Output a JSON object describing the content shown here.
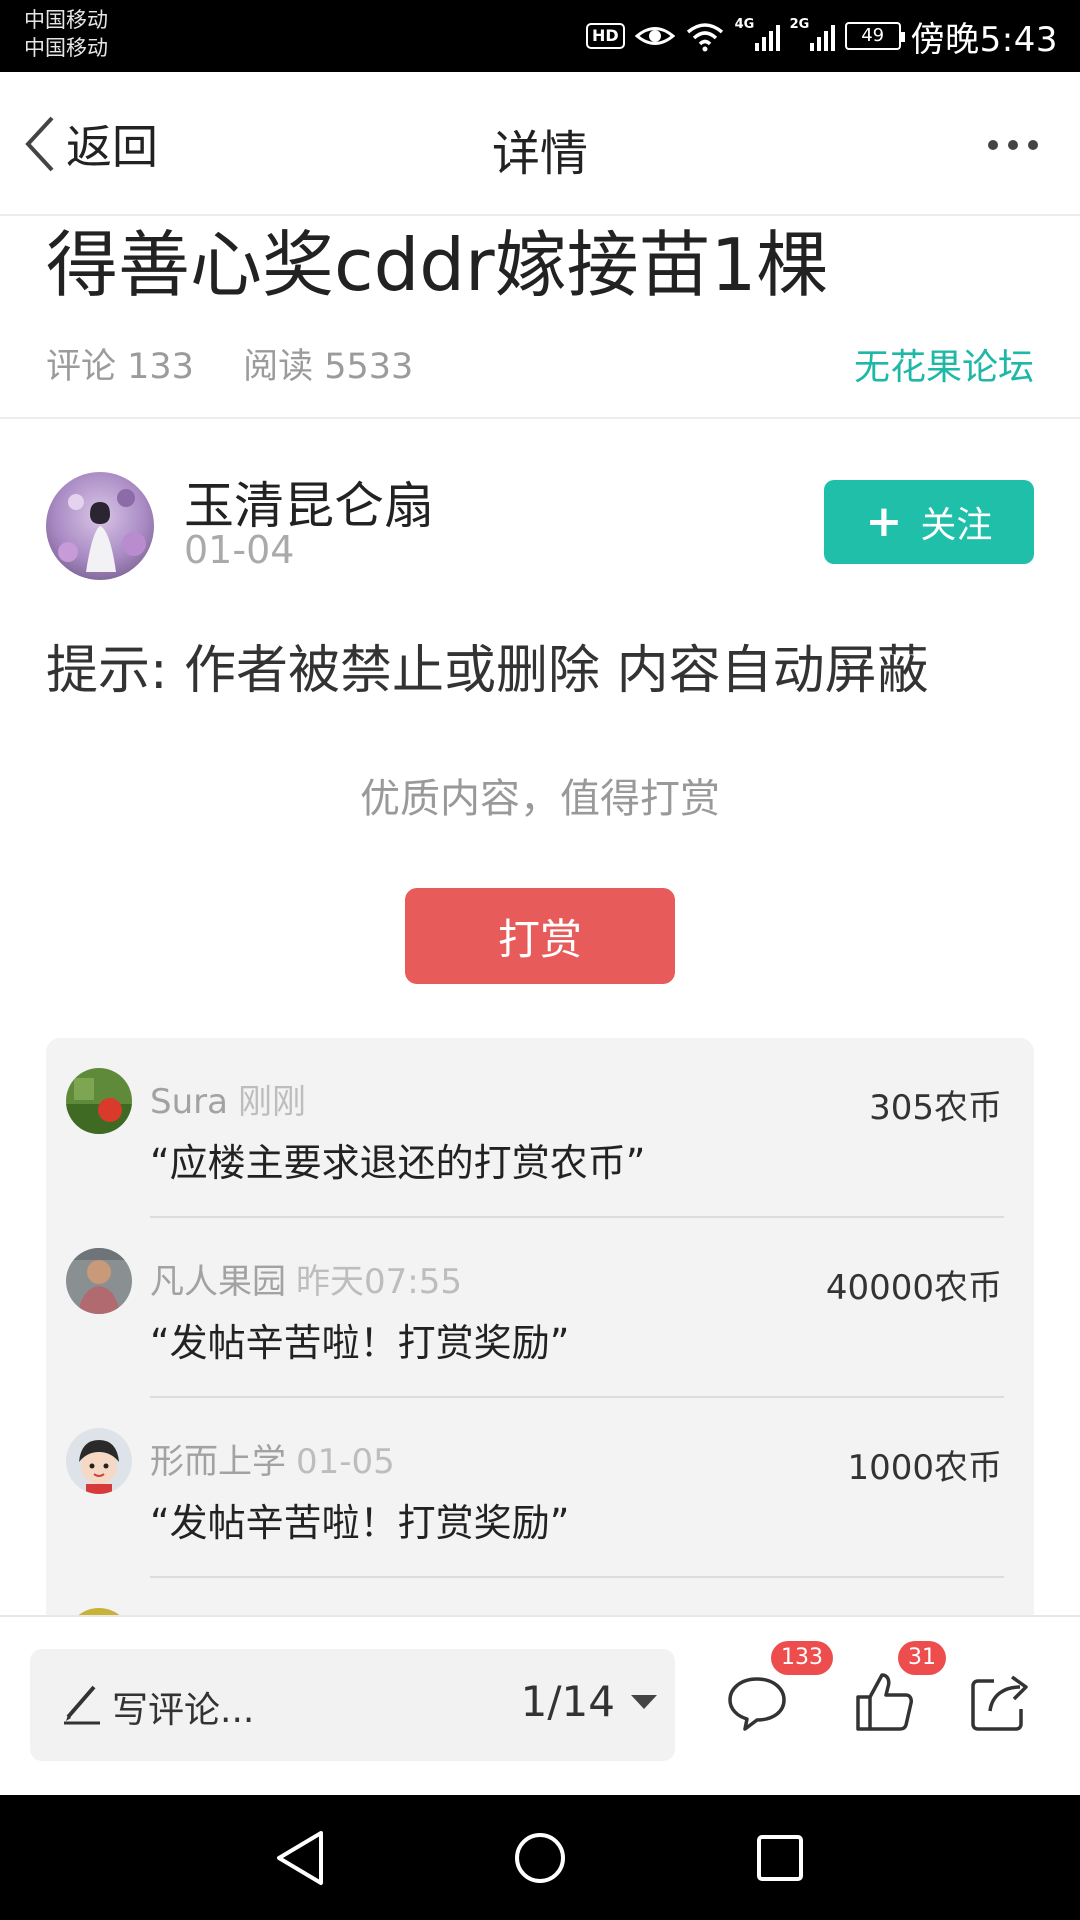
{
  "status_bar": {
    "carrier_1": "中国移动",
    "carrier_2": "中国移动",
    "hd": "HD",
    "net_1": "4G",
    "net_2": "2G",
    "battery": "49",
    "time": "傍晚5:43"
  },
  "header": {
    "back_label": "返回",
    "title": "详情"
  },
  "post": {
    "title": "得善心奖cddr嫁接苗1棵",
    "comments_label": "评论 133",
    "reads_label": "阅读 5533",
    "forum": "无花果论坛",
    "author_name": "玉清昆仑扇",
    "author_date": "01-04",
    "follow_plus": "+",
    "follow_label": "关注",
    "notice": "提示: 作者被禁止或删除 内容自动屏蔽"
  },
  "reward": {
    "hint": "优质内容，值得打赏",
    "button_label": "打赏",
    "items": [
      {
        "name": "Sura",
        "time": "刚刚",
        "amount": "305农币",
        "message": "“应楼主要求退还的打赏农币”"
      },
      {
        "name": "凡人果园",
        "time": "昨天07:55",
        "amount": "40000农币",
        "message": "“发帖辛苦啦！打赏奖励”"
      },
      {
        "name": "形而上学",
        "time": "01-05",
        "amount": "1000农币",
        "message": "“发帖辛苦啦！打赏奖励”"
      }
    ]
  },
  "bottom_bar": {
    "comment_placeholder": "写评论...",
    "page": "1/14",
    "comment_count": "133",
    "like_count": "31"
  },
  "colors": {
    "accent_teal": "#1fbfa9",
    "reward_red": "#e85b5b",
    "badge_red": "#ee4d4d"
  },
  "icons": [
    "back-chevron-icon",
    "more-dots-icon",
    "plus-icon",
    "pen-icon",
    "dropdown-triangle-icon",
    "comment-bubble-icon",
    "thumbs-up-icon",
    "share-icon",
    "nav-back-icon",
    "nav-home-icon",
    "nav-recents-icon"
  ]
}
